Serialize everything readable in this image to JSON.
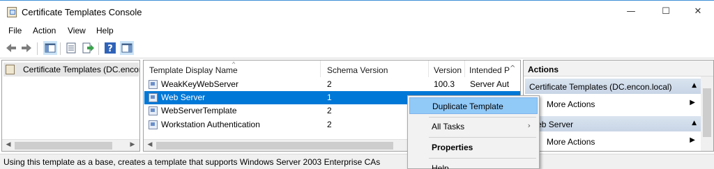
{
  "window": {
    "title": "Certificate Templates Console",
    "minimize_glyph": "—",
    "maximize_glyph": "☐",
    "close_glyph": "✕"
  },
  "menu": [
    "File",
    "Action",
    "View",
    "Help"
  ],
  "toolbar": {
    "icons": [
      "back-arrow-icon",
      "forward-arrow-icon",
      "show-hide-console-tree-icon",
      "properties-icon",
      "export-list-icon",
      "help-icon",
      "show-hide-action-pane-icon"
    ]
  },
  "tree": {
    "selected_label": "Certificate Templates (DC.encon.l"
  },
  "list": {
    "columns": [
      "Template Display Name",
      "Schema Version",
      "Version",
      "Intended P"
    ],
    "sort_indicator": "^",
    "rows": [
      {
        "name": "WeakKeyWebServer",
        "schema": "2",
        "version": "100.3",
        "purpose": "Server Aut"
      },
      {
        "name": "Web Server",
        "schema": "1",
        "version": "",
        "purpose": ""
      },
      {
        "name": "WebServerTemplate",
        "schema": "2",
        "version": "",
        "purpose": ""
      },
      {
        "name": "Workstation Authentication",
        "schema": "2",
        "version": "",
        "purpose": ""
      }
    ],
    "selected_index": 1
  },
  "actions": {
    "header": "Actions",
    "section1": {
      "title": "Certificate Templates (DC.encon.local)",
      "items": [
        "More Actions"
      ]
    },
    "section2": {
      "title": "Web Server",
      "items": [
        "More Actions"
      ]
    }
  },
  "context_menu": {
    "items": [
      "Duplicate Template",
      "All Tasks",
      "Properties",
      "Help"
    ],
    "highlighted_index": 0
  },
  "status": {
    "text": "Using this template as a base, creates a template that supports Windows Server 2003 Enterprise CAs"
  },
  "colors": {
    "selection": "#0078d7",
    "menu_highlight": "#91c9f7",
    "section_header": "#c8d5e6"
  }
}
